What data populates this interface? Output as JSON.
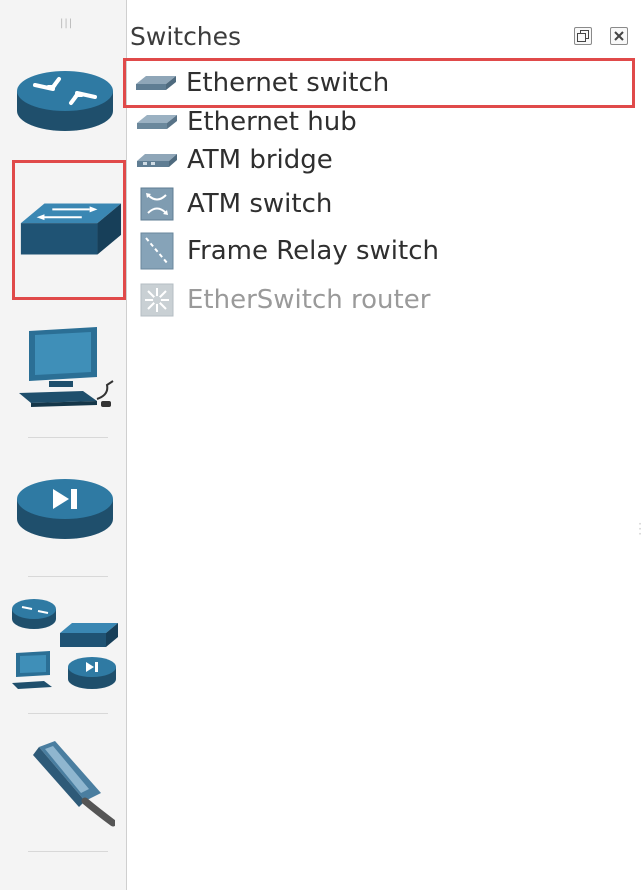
{
  "panel": {
    "title": "Switches",
    "items": [
      {
        "label": "Ethernet switch",
        "icon": "ethernet-switch-icon",
        "selected": true,
        "disabled": false
      },
      {
        "label": "Ethernet hub",
        "icon": "ethernet-hub-icon",
        "selected": false,
        "disabled": false
      },
      {
        "label": "ATM bridge",
        "icon": "atm-bridge-icon",
        "selected": false,
        "disabled": false
      },
      {
        "label": "ATM switch",
        "icon": "atm-switch-icon",
        "selected": false,
        "disabled": false
      },
      {
        "label": "Frame Relay switch",
        "icon": "frame-relay-switch-icon",
        "selected": false,
        "disabled": false
      },
      {
        "label": "EtherSwitch router",
        "icon": "etherswitch-router-icon",
        "selected": false,
        "disabled": true
      }
    ]
  },
  "toolbar": {
    "buttons": [
      {
        "name": "routers",
        "icon": "router-icon",
        "active": false
      },
      {
        "name": "switches",
        "icon": "switch-icon",
        "active": true
      },
      {
        "name": "end-devices",
        "icon": "computer-icon",
        "active": false
      },
      {
        "name": "security-devices",
        "icon": "security-device-icon",
        "active": false
      },
      {
        "name": "all-devices",
        "icon": "all-devices-icon",
        "active": false
      },
      {
        "name": "add-link",
        "icon": "cable-icon",
        "active": false
      }
    ]
  },
  "colors": {
    "highlight": "#e04a4a",
    "device_blue": "#2b6f95",
    "device_dark": "#1f4f6c"
  }
}
